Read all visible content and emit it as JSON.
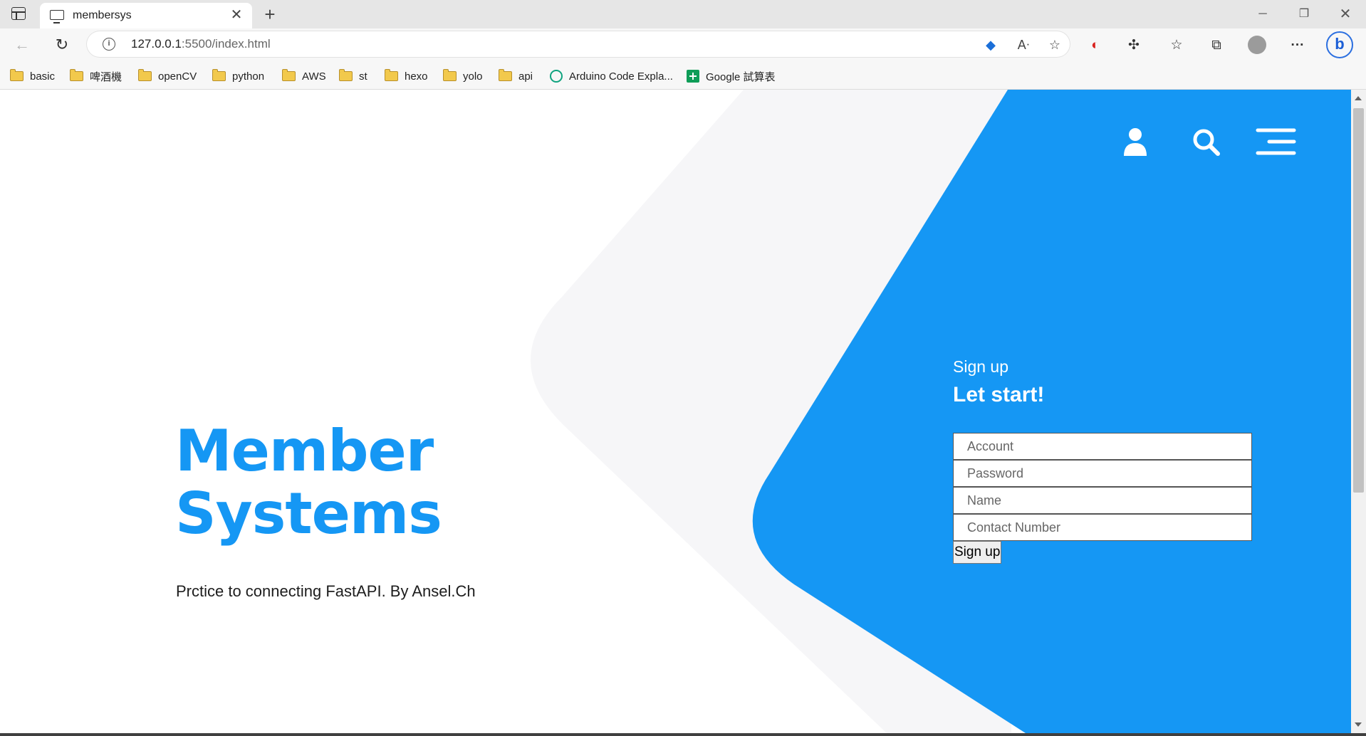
{
  "browser": {
    "tab_title": "membersys",
    "url_host": "127.0.0.1",
    "url_rest": ":5500/index.html",
    "bookmarks": [
      {
        "label": "basic",
        "type": "folder"
      },
      {
        "label": "啤酒機",
        "type": "folder"
      },
      {
        "label": "openCV",
        "type": "folder"
      },
      {
        "label": "python",
        "type": "folder"
      },
      {
        "label": "AWS",
        "type": "folder"
      },
      {
        "label": "st",
        "type": "folder"
      },
      {
        "label": "hexo",
        "type": "folder"
      },
      {
        "label": "yolo",
        "type": "folder"
      },
      {
        "label": "api",
        "type": "folder"
      },
      {
        "label": "Arduino Code Expla...",
        "type": "site"
      },
      {
        "label": "Google 試算表",
        "type": "sheet"
      }
    ]
  },
  "hero": {
    "title_line1": "Member",
    "title_line2": "Systems",
    "subtitle": "Prctice to connecting FastAPI. By Ansel.Ch"
  },
  "form": {
    "kicker": "Sign up",
    "heading": "Let start!",
    "account_placeholder": "Account",
    "password_placeholder": "Password",
    "name_placeholder": "Name",
    "contact_placeholder": "Contact Number",
    "submit_label": "Sign up"
  },
  "colors": {
    "accent": "#1597f4",
    "panel": "#1597f4",
    "bg_shape": "#f6f6f8"
  },
  "icons": [
    "user-icon",
    "search-icon",
    "menu-icon"
  ]
}
